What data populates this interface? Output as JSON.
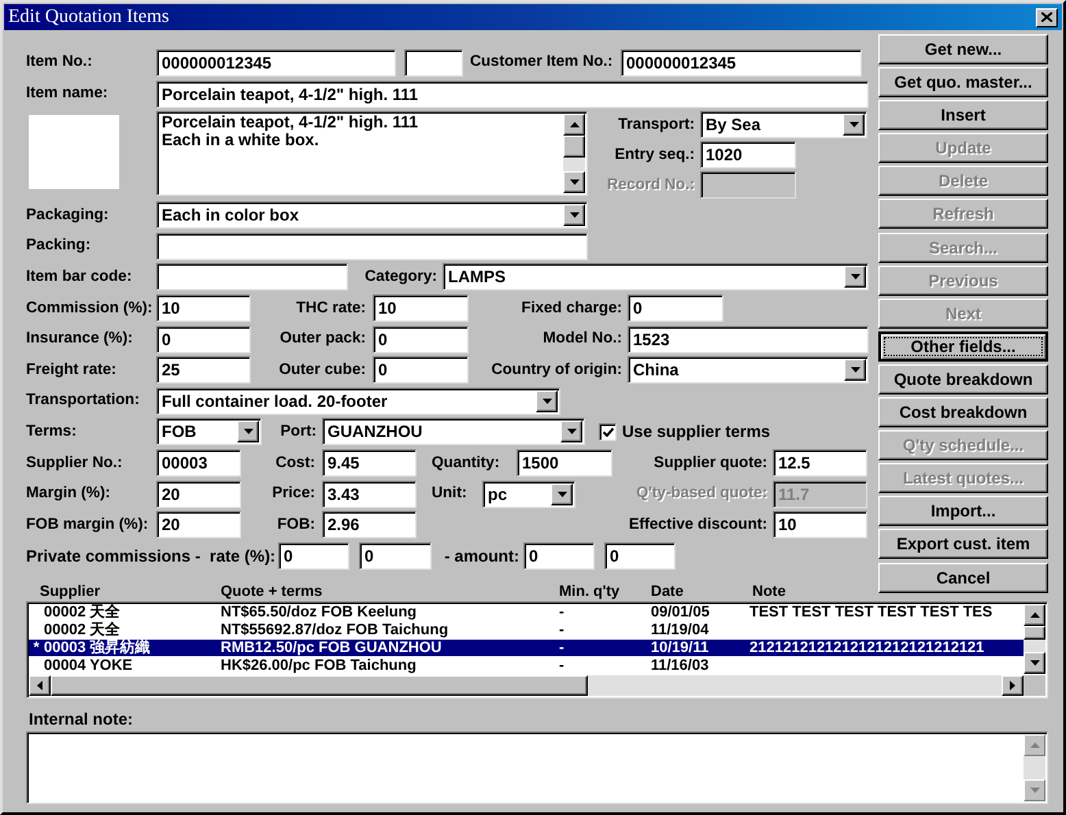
{
  "window": {
    "title": "Edit Quotation Items"
  },
  "item_no": {
    "label": "Item No.:",
    "value": "000000012345"
  },
  "customer_item_no": {
    "label": "Customer Item No.:",
    "value": "000000012345"
  },
  "item_name": {
    "label": "Item name:",
    "value": "Porcelain teapot, 4-1/2\" high. 111"
  },
  "description": {
    "lines": [
      "Porcelain teapot, 4-1/2\" high. 111",
      "Each in a white box."
    ]
  },
  "transport": {
    "label": "Transport:",
    "value": "By Sea"
  },
  "entry_seq": {
    "label": "Entry seq.:",
    "value": "1020"
  },
  "record_no": {
    "label": "Record No.:",
    "disabled": true
  },
  "packaging": {
    "label": "Packaging:",
    "value": "Each in color box"
  },
  "packing": {
    "label": "Packing:"
  },
  "item_bar_code": {
    "label": "Item bar code:"
  },
  "category": {
    "label": "Category:",
    "value": "LAMPS"
  },
  "commission": {
    "label": "Commission (%):",
    "value": "10"
  },
  "thc_rate": {
    "label": "THC rate:",
    "value": "10"
  },
  "fixed_charge": {
    "label": "Fixed charge:",
    "value": "0"
  },
  "insurance": {
    "label": "Insurance (%):",
    "value": "0"
  },
  "outer_pack": {
    "label": "Outer pack:",
    "value": "0"
  },
  "model_no": {
    "label": "Model No.:",
    "value": "1523"
  },
  "freight_rate": {
    "label": "Freight rate:",
    "value": "25"
  },
  "outer_cube": {
    "label": "Outer cube:",
    "value": "0"
  },
  "country_of_origin": {
    "label": "Country of origin:",
    "value": "China"
  },
  "transportation": {
    "label": "Transportation:",
    "value": "Full container load. 20-footer"
  },
  "terms": {
    "label": "Terms:",
    "value": "FOB"
  },
  "port": {
    "label": "Port:",
    "value": "GUANZHOU"
  },
  "use_supplier_terms": {
    "label": "Use supplier terms",
    "checked": true
  },
  "supplier_no": {
    "label": "Supplier No.:",
    "value": "00003"
  },
  "cost": {
    "label": "Cost:",
    "value": "9.45"
  },
  "quantity": {
    "label": "Quantity:",
    "value": "1500"
  },
  "supplier_quote": {
    "label": "Supplier quote:",
    "value": "12.5"
  },
  "margin": {
    "label": "Margin (%):",
    "value": "20"
  },
  "price": {
    "label": "Price:",
    "value": "3.43"
  },
  "unit": {
    "label": "Unit:",
    "value": "pc"
  },
  "qty_based_quote": {
    "label": "Q'ty-based quote:",
    "value": "11.7",
    "disabled": true
  },
  "fob_margin": {
    "label": "FOB margin (%):",
    "value": "20"
  },
  "fob": {
    "label": "FOB:",
    "value": "2.96"
  },
  "effective_discount": {
    "label": "Effective discount:",
    "value": "10"
  },
  "private_commissions": {
    "label": "Private commissions -  rate (%):",
    "rates": [
      "0",
      "0"
    ],
    "amount_label": "- amount:",
    "amounts": [
      "0",
      "0"
    ]
  },
  "buttons": [
    {
      "label": "Get new...",
      "disabled": false,
      "focused": false
    },
    {
      "label": "Get quo. master...",
      "disabled": false,
      "focused": false
    },
    {
      "label": "Insert",
      "disabled": false,
      "focused": false
    },
    {
      "label": "Update",
      "disabled": true,
      "focused": false
    },
    {
      "label": "Delete",
      "disabled": true,
      "focused": false
    },
    {
      "label": "Refresh",
      "disabled": true,
      "focused": false
    },
    {
      "label": "Search...",
      "disabled": true,
      "focused": false
    },
    {
      "label": "Previous",
      "disabled": true,
      "focused": false
    },
    {
      "label": "Next",
      "disabled": true,
      "focused": false
    },
    {
      "label": "Other fields...",
      "disabled": false,
      "focused": true
    },
    {
      "label": "Quote breakdown",
      "disabled": false,
      "focused": false
    },
    {
      "label": "Cost breakdown",
      "disabled": false,
      "focused": false
    },
    {
      "label": "Q'ty schedule...",
      "disabled": true,
      "focused": false
    },
    {
      "label": "Latest quotes...",
      "disabled": true,
      "focused": false
    },
    {
      "label": "Import...",
      "disabled": false,
      "focused": false
    },
    {
      "label": "Export cust. item",
      "disabled": false,
      "focused": false
    },
    {
      "label": "Cancel",
      "disabled": false,
      "focused": false
    }
  ],
  "supplier_list": {
    "columns": [
      "Supplier",
      "Quote + terms",
      "Min. q'ty",
      "Date",
      "Note"
    ],
    "rows": [
      {
        "selected": false,
        "cells": [
          "00002 天全",
          "NT$65.50/doz FOB Keelung",
          "-",
          "09/01/05",
          "TEST TEST TEST TEST TEST TES"
        ]
      },
      {
        "selected": false,
        "cells": [
          "00002 天全",
          "NT$55692.87/doz FOB Taichung",
          "-",
          "11/19/04"
        ]
      },
      {
        "selected": true,
        "marker": "*",
        "cells": [
          "00003 強昇紡織",
          "RMB12.50/pc FOB GUANZHOU",
          "-",
          "10/19/11",
          "2121212121212121212121212121"
        ]
      },
      {
        "selected": false,
        "cells": [
          "00004 YOKE",
          "HK$26.00/pc FOB Taichung",
          "-",
          "11/16/03"
        ]
      }
    ]
  },
  "internal_note": {
    "label": "Internal note:"
  }
}
